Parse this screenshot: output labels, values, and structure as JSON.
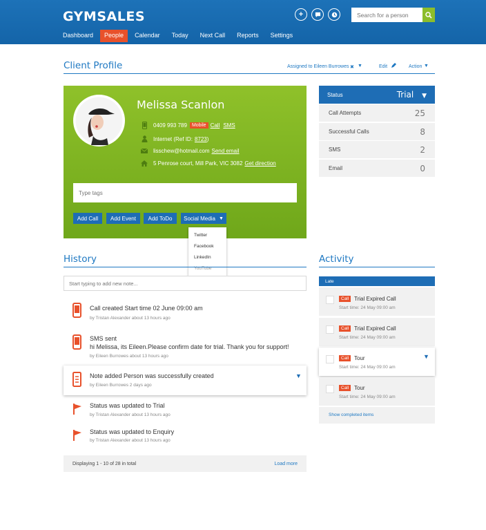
{
  "brand": {
    "logo": "GYMSALES",
    "primary": "#1e6db5",
    "accent": "#e8512b",
    "green": "#8fc12a"
  },
  "nav": [
    "Dashboard",
    "People",
    "Calendar",
    "Today",
    "Next Call",
    "Reports",
    "Settings"
  ],
  "nav_active": "People",
  "search": {
    "placeholder": "Search for a person"
  },
  "header_icons": [
    "plus-icon",
    "chat-icon",
    "clock-icon"
  ],
  "client_profile": {
    "title": "Client Profile",
    "assigned": "Assigned to Eileen Burrowes",
    "assigned_clear": "✖",
    "assigned_caret": "▼",
    "edit": "Edit",
    "action": "Action",
    "action_caret": "▼"
  },
  "profile": {
    "name": "Melissa Scanlon",
    "phone": "0409 993 789",
    "phone_badge": "Mobile",
    "call_link": "Call",
    "sms_link": "SMS",
    "source": "Internet (Ref ID:",
    "ref_id": "8723",
    "ref_close": ")",
    "email": "lisschew@hotmail.com",
    "email_link": "Send email",
    "address": "5 Penrose court, Mill Park, VIC 3082",
    "address_link": "Get direction",
    "tags_placeholder": "Type tags",
    "buttons": [
      "Add Call",
      "Add Event",
      "Add ToDo",
      "Social Media"
    ],
    "social_caret": "▼",
    "social_menu": [
      "Twitter",
      "Facebook",
      "LinkedIn",
      "YouTube"
    ]
  },
  "status_panel": {
    "label": "Status",
    "value": "Trial",
    "caret": "▼",
    "rows": [
      {
        "label": "Call Attempts",
        "value": "25"
      },
      {
        "label": "Successful Calls",
        "value": "8"
      },
      {
        "label": "SMS",
        "value": "2"
      },
      {
        "label": "Email",
        "value": "0"
      }
    ]
  },
  "history": {
    "title": "History",
    "note_placeholder": "Start typing to add new note...",
    "items": [
      {
        "icon": "phone-icon",
        "title": "Call created Start time 02 June 09:00 am",
        "meta": "by Tristan Alexander about 13 hours ago"
      },
      {
        "icon": "phone-icon",
        "title": "SMS sent",
        "title2": "hi Melissa, its Eileen.Please confirm date for trial. Thank you for support!",
        "meta": "by Eileen Burrowes about 13 hours ago"
      },
      {
        "icon": "note-icon",
        "title": "Note added Person was successfully created",
        "meta": "by Eileen Burrowes 2 days ago",
        "caret": "▼"
      },
      {
        "icon": "flag-icon",
        "title": "Status was updated to Trial",
        "meta": "by Tristan Alexander about 13 hours ago"
      },
      {
        "icon": "flag-icon",
        "title": "Status was updated to Enquiry",
        "meta": "by Tristan Alexander about 13 hours ago"
      }
    ],
    "footer": "Displaying 1 - 10 of 28 in total",
    "load_more": "Load more"
  },
  "activity": {
    "title": "Activity",
    "group": "Late",
    "items": [
      {
        "badge": "Call",
        "title": "Trial Expired Call",
        "meta": "Start time: 24 May 09:00 am"
      },
      {
        "badge": "Call",
        "title": "Trial Expired Call",
        "meta": "Start time: 24 May 09:00 am"
      },
      {
        "badge": "Call",
        "title": "Tour",
        "meta": "Start time: 24 May 09:00 am",
        "caret": "▼"
      },
      {
        "badge": "Call",
        "title": "Tour",
        "meta": "Start time: 24 May 09:00 am"
      }
    ],
    "show_completed": "Show completed items"
  }
}
